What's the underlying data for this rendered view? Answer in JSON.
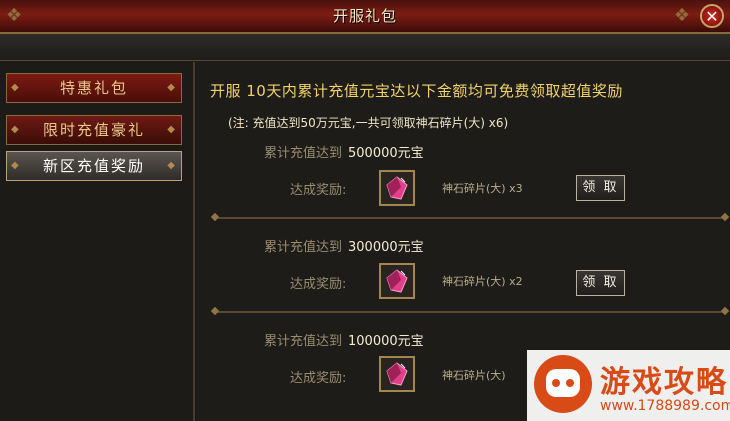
{
  "window": {
    "title": "开服礼包",
    "close_symbol": "✕"
  },
  "tabs": [
    {
      "label": "特惠礼包"
    },
    {
      "label": "限时充值豪礼"
    },
    {
      "label": "新区充值奖励"
    }
  ],
  "headline": "开服  10天内累计充值元宝达以下金额均可免费领取超值奖励",
  "note": "(注: 充值达到50万元宝,一共可领取神石碎片(大) x6)",
  "req_label": "累计充值达到",
  "reward_label": "达成奖励:",
  "tiers": [
    {
      "amount": "500000元宝",
      "item": "神石碎片(大) x3",
      "button": "领 取"
    },
    {
      "amount": "300000元宝",
      "item": "神石碎片(大) x2",
      "button": "领 取"
    },
    {
      "amount": "100000元宝",
      "item": "神石碎片(大)"
    }
  ],
  "watermark": {
    "title": "游戏攻略",
    "url": "www.1788989.com"
  },
  "colors": {
    "accent_gold": "#f0d36a",
    "title_red": "#7c1c12",
    "gem_pink": "#e0408a"
  }
}
